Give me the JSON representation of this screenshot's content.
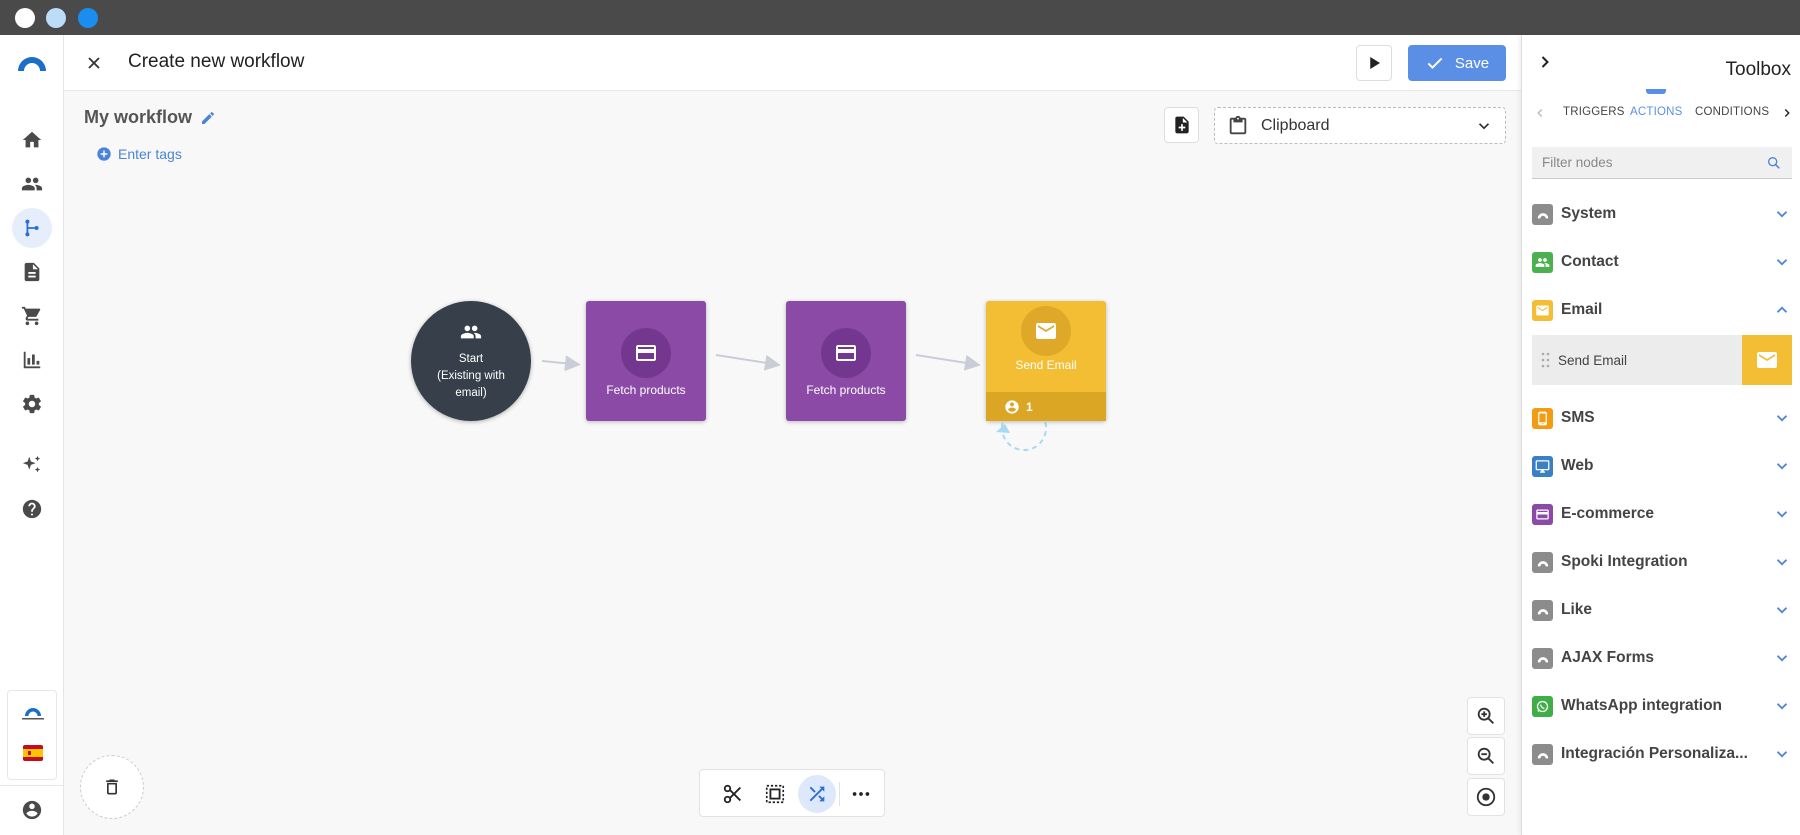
{
  "header": {
    "title": "Create new workflow",
    "save_label": "Save"
  },
  "workflow": {
    "name": "My workflow",
    "tags_label": "Enter tags"
  },
  "clipboard": {
    "label": "Clipboard"
  },
  "nodes": {
    "start": {
      "line1": "Start",
      "line2": "(Existing with",
      "line3": "email)"
    },
    "fetch1": {
      "label": "Fetch products"
    },
    "fetch2": {
      "label": "Fetch products"
    },
    "send": {
      "label": "Send Email",
      "count": "1"
    }
  },
  "toolbox": {
    "title": "Toolbox",
    "tabs": [
      "TRIGGERS",
      "ACTIONS",
      "CONDITIONS"
    ],
    "active_tab": "ACTIONS",
    "filter_placeholder": "Filter nodes",
    "categories": [
      {
        "label": "System",
        "icon": "system-icon",
        "color": "#8c8c8c",
        "expanded": false
      },
      {
        "label": "Contact",
        "icon": "contacts-icon",
        "color": "#4caf50",
        "expanded": false
      },
      {
        "label": "Email",
        "icon": "email-icon",
        "color": "#f3bd34",
        "expanded": true
      },
      {
        "label": "SMS",
        "icon": "phone-icon",
        "color": "#f39c12",
        "expanded": false
      },
      {
        "label": "Web",
        "icon": "monitor-icon",
        "color": "#3b7fc4",
        "expanded": false
      },
      {
        "label": "E-commerce",
        "icon": "card-icon",
        "color": "#8a4aa6",
        "expanded": false
      },
      {
        "label": "Spoki Integration",
        "icon": "system-icon",
        "color": "#8c8c8c",
        "expanded": false
      },
      {
        "label": "Like",
        "icon": "system-icon",
        "color": "#8c8c8c",
        "expanded": false
      },
      {
        "label": "AJAX Forms",
        "icon": "system-icon",
        "color": "#8c8c8c",
        "expanded": false
      },
      {
        "label": "WhatsApp integration",
        "icon": "whatsapp-icon",
        "color": "#3fae49",
        "expanded": false
      },
      {
        "label": "Integración Personaliza...",
        "icon": "system-icon",
        "color": "#8c8c8c",
        "expanded": false
      }
    ],
    "email_items": [
      {
        "label": "Send Email"
      }
    ]
  },
  "colors": {
    "accent": "#5b8fe6",
    "start_node": "#37404a",
    "fetch_node": "#8a4aa6",
    "email_node": "#f3bd34"
  }
}
